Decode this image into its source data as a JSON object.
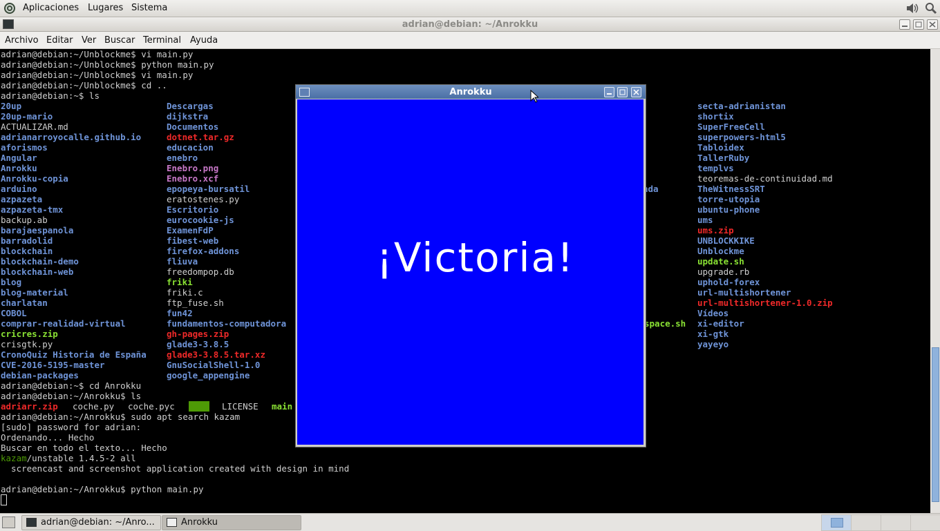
{
  "top_panel": {
    "menus": [
      "Aplicaciones",
      "Lugares",
      "Sistema"
    ],
    "icons": [
      "gnome-foot-icon",
      "volume-icon",
      "network-icon"
    ]
  },
  "terminal_window": {
    "title": "adrian@debian: ~/Anrokku",
    "menus": [
      "Archivo",
      "Editar",
      "Ver",
      "Buscar",
      "Terminal",
      "Ayuda"
    ]
  },
  "terminal": {
    "lines_top": [
      "adrian@debian:~/Unblockme$ vi main.py",
      "adrian@debian:~/Unblockme$ python main.py",
      "adrian@debian:~/Unblockme$ vi main.py",
      "adrian@debian:~/Unblockme$ cd ..",
      "adrian@debian:~$ ls"
    ],
    "ls_col1": [
      {
        "t": "20up",
        "c": "dir"
      },
      {
        "t": "20up-mario",
        "c": "dir"
      },
      {
        "t": "ACTUALIZAR.md",
        "c": "file"
      },
      {
        "t": "adrianarroyocalle.github.io",
        "c": "dir"
      },
      {
        "t": "aforismos",
        "c": "dir"
      },
      {
        "t": "Angular",
        "c": "dir"
      },
      {
        "t": "Anrokku",
        "c": "dir"
      },
      {
        "t": "Anrokku-copia",
        "c": "dir"
      },
      {
        "t": "arduino",
        "c": "dir"
      },
      {
        "t": "azpazeta",
        "c": "dir"
      },
      {
        "t": "azpazeta-tmx",
        "c": "dir"
      },
      {
        "t": "backup.ab",
        "c": "file"
      },
      {
        "t": "barajaespanola",
        "c": "dir"
      },
      {
        "t": "barradolid",
        "c": "dir"
      },
      {
        "t": "blockchain",
        "c": "dir"
      },
      {
        "t": "blockchain-demo",
        "c": "dir"
      },
      {
        "t": "blockchain-web",
        "c": "dir"
      },
      {
        "t": "blog",
        "c": "dir"
      },
      {
        "t": "blog-material",
        "c": "dir"
      },
      {
        "t": "charlatan",
        "c": "dir"
      },
      {
        "t": "COBOL",
        "c": "dir"
      },
      {
        "t": "comprar-realidad-virtual",
        "c": "dir"
      },
      {
        "t": "cricres.zip",
        "c": "exec"
      },
      {
        "t": "crisgtk.py",
        "c": "file"
      },
      {
        "t": "CronoQuiz Historia de España",
        "c": "dir"
      },
      {
        "t": "CVE-2016-5195-master",
        "c": "dir"
      },
      {
        "t": "debian-packages",
        "c": "dir"
      }
    ],
    "ls_col2": [
      {
        "t": "Descargas",
        "c": "dir"
      },
      {
        "t": "dijkstra",
        "c": "dir"
      },
      {
        "t": "Documentos",
        "c": "dir"
      },
      {
        "t": "dotnet.tar.gz",
        "c": "arch"
      },
      {
        "t": "educacion",
        "c": "dir"
      },
      {
        "t": "enebro",
        "c": "dir"
      },
      {
        "t": "Enebro.png",
        "c": "img"
      },
      {
        "t": "Enebro.xcf",
        "c": "img"
      },
      {
        "t": "epopeya-bursatil",
        "c": "dir"
      },
      {
        "t": "eratostenes.py",
        "c": "file"
      },
      {
        "t": "Escritorio",
        "c": "dir"
      },
      {
        "t": "eurocookie-js",
        "c": "dir"
      },
      {
        "t": "ExamenFdP",
        "c": "dir"
      },
      {
        "t": "fibest-web",
        "c": "dir"
      },
      {
        "t": "firefox-addons",
        "c": "dir"
      },
      {
        "t": "fliuva",
        "c": "dir"
      },
      {
        "t": "freedompop.db",
        "c": "file"
      },
      {
        "t": "friki",
        "c": "exec"
      },
      {
        "t": "friki.c",
        "c": "file"
      },
      {
        "t": "ftp_fuse.sh",
        "c": "file"
      },
      {
        "t": "fun42",
        "c": "dir"
      },
      {
        "t": "fundamentos-computadora",
        "c": "dir"
      },
      {
        "t": "gh-pages.zip",
        "c": "arch"
      },
      {
        "t": "glade3-3.8.5",
        "c": "dir"
      },
      {
        "t": "glade3-3.8.5.tar.xz",
        "c": "arch"
      },
      {
        "t": "GnuSocialShell-1.0",
        "c": "dir"
      },
      {
        "t": "google_appengine",
        "c": "dir"
      }
    ],
    "ls_col3_fragments": [
      {
        "t": "nda",
        "c": "dir",
        "row": 8
      },
      {
        "t": "space.sh",
        "c": "exec",
        "row": 21
      }
    ],
    "ls_col4": [
      {
        "t": "secta-adrianistan",
        "c": "dir"
      },
      {
        "t": "shortix",
        "c": "dir"
      },
      {
        "t": "SuperFreeCell",
        "c": "dir"
      },
      {
        "t": "superpowers-html5",
        "c": "dir"
      },
      {
        "t": "Tabloidex",
        "c": "dir"
      },
      {
        "t": "TallerRuby",
        "c": "dir"
      },
      {
        "t": "templvs",
        "c": "dir"
      },
      {
        "t": "teoremas-de-continuidad.md",
        "c": "file"
      },
      {
        "t": "TheWitnessSRT",
        "c": "dir"
      },
      {
        "t": "torre-utopia",
        "c": "dir"
      },
      {
        "t": "ubuntu-phone",
        "c": "dir"
      },
      {
        "t": "ums",
        "c": "dir"
      },
      {
        "t": "ums.zip",
        "c": "arch"
      },
      {
        "t": "UNBLOCKKIKE",
        "c": "dir"
      },
      {
        "t": "Unblockme",
        "c": "dir"
      },
      {
        "t": "update.sh",
        "c": "exec"
      },
      {
        "t": "upgrade.rb",
        "c": "file"
      },
      {
        "t": "uphold-forex",
        "c": "dir"
      },
      {
        "t": "url-multishortener",
        "c": "dir"
      },
      {
        "t": "url-multishortener-1.0.zip",
        "c": "arch"
      },
      {
        "t": "Vídeos",
        "c": "dir"
      },
      {
        "t": "xi-editor",
        "c": "dir"
      },
      {
        "t": "xi-gtk",
        "c": "dir"
      },
      {
        "t": "yayeyo",
        "c": "dir"
      }
    ],
    "cd_line": "adrian@debian:~$ cd Anrokku",
    "ls_line": "adrian@debian:~/Anrokku$ ls",
    "anrokku_ls": [
      {
        "t": "adriarr.zip",
        "c": "arch"
      },
      {
        "t": "coche.py",
        "c": "file"
      },
      {
        "t": "coche.pyc",
        "c": "file"
      },
      {
        "t": "data",
        "c": "hl"
      },
      {
        "t": "LICENSE",
        "c": "file"
      },
      {
        "t": "main",
        "c": "exec"
      }
    ],
    "lines_bottom": [
      "adrian@debian:~/Anrokku$ sudo apt search kazam",
      "[sudo] password for adrian:",
      "Ordenando... Hecho",
      "Buscar en todo el texto... Hecho"
    ],
    "kazam_pkg": "kazam",
    "kazam_rest": "/unstable 1.4.5-2 all",
    "kazam_desc": "  screencast and screenshot application created with design in mind",
    "last_cmd": "adrian@debian:~/Anrokku$ python main.py"
  },
  "anrokku_window": {
    "title": "Anrokku",
    "message": "¡Victoria!",
    "background": "#0000ff"
  },
  "taskbar": {
    "tasks": [
      "adrian@debian: ~/Anro...",
      "Anrokku"
    ]
  }
}
